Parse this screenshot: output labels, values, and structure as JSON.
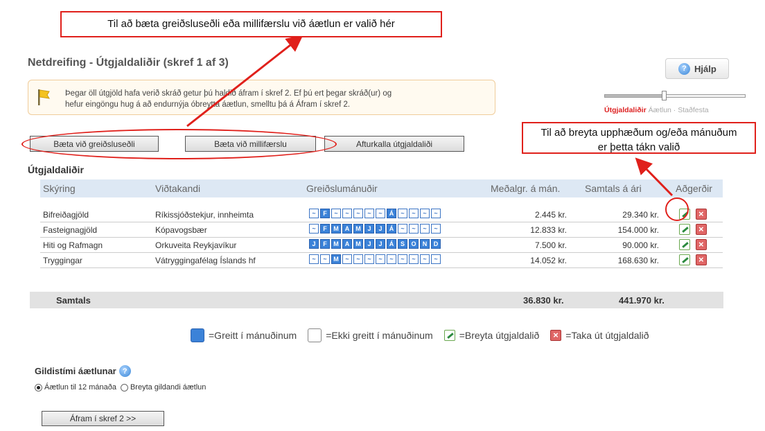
{
  "callouts": {
    "top": "Til að bæta greiðsluseðli eða millifærslu við áætlun er valið hér",
    "right_line1": "Til að breyta upphæðum og/eða mánuðum",
    "right_line2": "er þetta tákn valið"
  },
  "page": {
    "title": "Netdreifing - Útgjaldaliðir (skref 1 af 3)",
    "help_label": "Hjálp"
  },
  "info": {
    "line1": "Þegar öll útgjöld hafa verið skráð getur þú haldið áfram í skref 2. Ef þú ert þegar skráð(ur) og",
    "line2": "hefur eingöngu hug á að endurnýja óbreytta áætlun, smelltu þá á Áfram í skref 2."
  },
  "steps": {
    "step1": "Útgjaldaliðir",
    "step2": "Áætlun",
    "step3": "Staðfesta",
    "progress": 0.41
  },
  "buttons": {
    "add_bill": "Bæta við greiðsluseðli",
    "add_transfer": "Bæta við millifærslu",
    "undo": "Afturkalla útgjaldaliði",
    "continue": "Áfram í skref 2 >>"
  },
  "table": {
    "section_title": "Útgjaldaliðir",
    "headers": [
      "Skýring",
      "Viðtakandi",
      "Greiðslumánuðir",
      "Meðalgr. á mán.",
      "Samtals á ári",
      "Aðgerðir"
    ],
    "rows": [
      {
        "desc": "Bifreiðagjöld",
        "payee": "Ríkissjóðstekjur, innheimta",
        "months": [
          "~",
          "F",
          "~",
          "~",
          "~",
          "~",
          "~",
          "Á",
          "~",
          "~",
          "~",
          "~"
        ],
        "paid": [
          false,
          true,
          false,
          false,
          false,
          false,
          false,
          true,
          false,
          false,
          false,
          false
        ],
        "monthly": "2.445 kr.",
        "yearly": "29.340 kr."
      },
      {
        "desc": "Fasteignagjöld",
        "payee": "Kópavogsbær",
        "months": [
          "~",
          "F",
          "M",
          "A",
          "M",
          "J",
          "J",
          "Á",
          "~",
          "~",
          "~",
          "~"
        ],
        "paid": [
          false,
          true,
          true,
          true,
          true,
          true,
          true,
          true,
          false,
          false,
          false,
          false
        ],
        "monthly": "12.833 kr.",
        "yearly": "154.000 kr."
      },
      {
        "desc": "Hiti og Rafmagn",
        "payee": "Orkuveita Reykjavíkur",
        "months": [
          "J",
          "F",
          "M",
          "A",
          "M",
          "J",
          "J",
          "Á",
          "S",
          "O",
          "N",
          "D"
        ],
        "paid": [
          true,
          true,
          true,
          true,
          true,
          true,
          true,
          true,
          true,
          true,
          true,
          true
        ],
        "monthly": "7.500 kr.",
        "yearly": "90.000 kr."
      },
      {
        "desc": "Tryggingar",
        "payee": "Vátryggingafélag Íslands hf",
        "months": [
          "~",
          "~",
          "M",
          "~",
          "~",
          "~",
          "~",
          "~",
          "~",
          "~",
          "~",
          "~"
        ],
        "paid": [
          false,
          false,
          true,
          false,
          false,
          false,
          false,
          false,
          false,
          false,
          false,
          false
        ],
        "monthly": "14.052 kr.",
        "yearly": "168.630 kr."
      }
    ],
    "total_label": "Samtals",
    "total_monthly": "36.830",
    "total_yearly": "441.970",
    "currency": "kr."
  },
  "legend": {
    "paid": "=Greitt í mánuðinum",
    "unpaid": "=Ekki greitt í mánuðinum",
    "edit": "=Breyta útgjaldalið",
    "delete": "=Taka út útgjaldalið"
  },
  "validity": {
    "title": "Gildistími áætlunar",
    "option1": "Áætlun til 12 mánaða",
    "option2": "Breyta gildandi áætlun",
    "selected": "option1"
  }
}
